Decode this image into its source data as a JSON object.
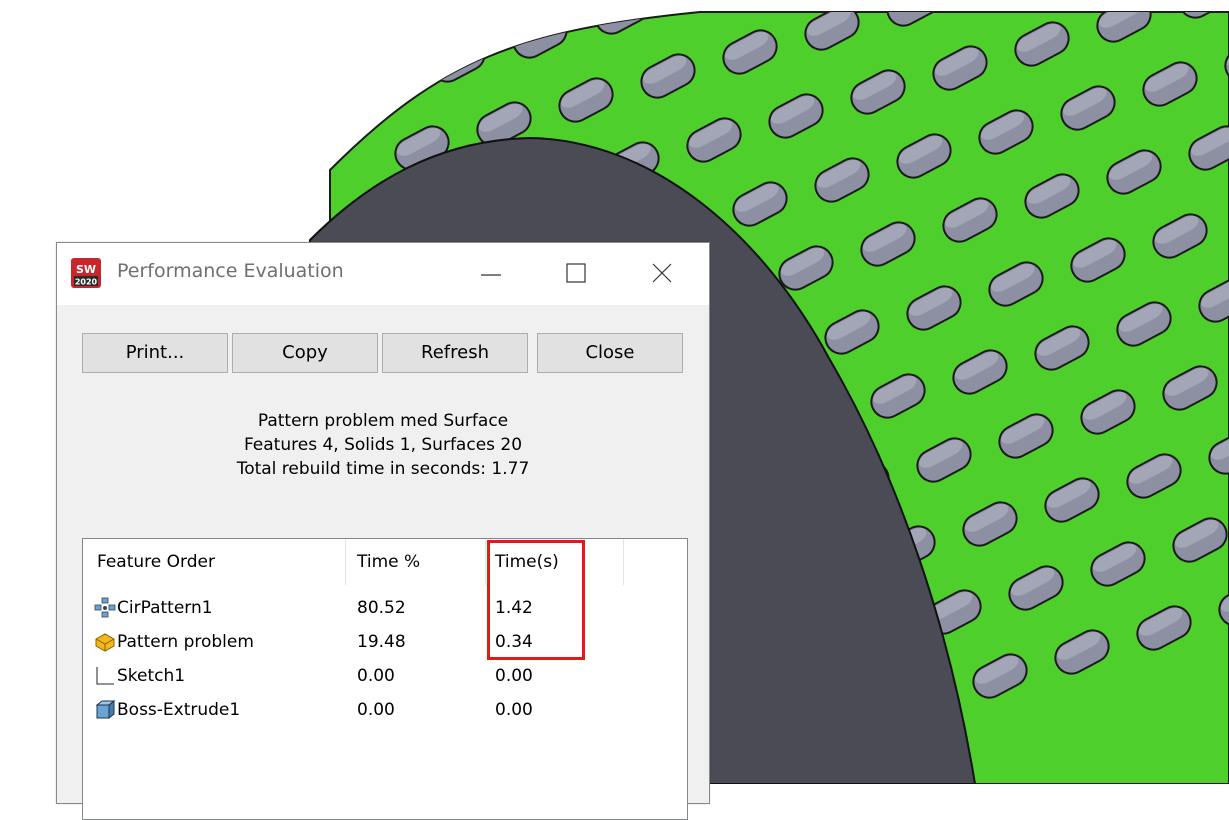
{
  "dialog": {
    "title": "Performance Evaluation",
    "app_icon_text": "SW 2020",
    "buttons": {
      "print": "Print...",
      "copy": "Copy",
      "refresh": "Refresh",
      "close": "Close"
    },
    "summary": {
      "model_name": "Pattern problem med Surface",
      "counts": "Features 4, Solids 1, Surfaces 20",
      "total_time": "Total rebuild time in seconds: 1.77"
    },
    "table": {
      "headers": [
        "Feature Order",
        "Time %",
        "Time(s)"
      ],
      "rows": [
        {
          "icon": "circular-pattern-icon",
          "name": "CirPattern1",
          "percent": "80.52",
          "seconds": "1.42"
        },
        {
          "icon": "part-icon",
          "name": "Pattern problem",
          "percent": "19.48",
          "seconds": "0.34"
        },
        {
          "icon": "sketch-icon",
          "name": "Sketch1",
          "percent": "0.00",
          "seconds": "0.00"
        },
        {
          "icon": "extrude-icon",
          "name": "Boss-Extrude1",
          "percent": "0.00",
          "seconds": "0.00"
        }
      ]
    }
  },
  "colors": {
    "model_green": "#4fcf2c",
    "key_grey": "#7c7e8f",
    "end_face": "#4a4b54",
    "highlight": "#e21a1a"
  }
}
